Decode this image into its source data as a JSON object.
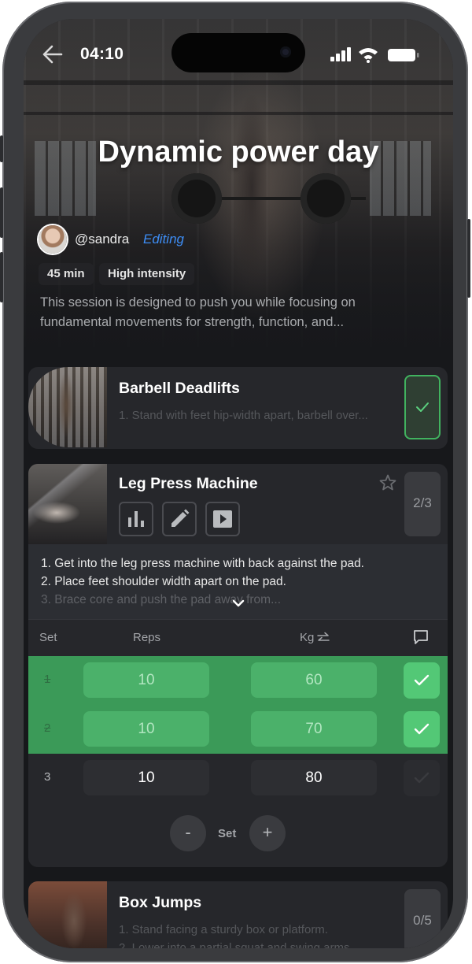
{
  "status_bar": {
    "time": "04:10"
  },
  "workout": {
    "title": "Dynamic power day",
    "author": "@sandra",
    "mode": "Editing",
    "duration": "45 min",
    "intensity": "High intensity",
    "description": "This session is designed to push you while focusing on fundamental movements for strength, function, and..."
  },
  "exercises": [
    {
      "name": "Barbell Deadlifts",
      "preview": "1. Stand with feet hip-width apart, barbell over...",
      "completed": true
    },
    {
      "name": "Leg Press Machine",
      "progress": "2/3",
      "instructions": [
        "1. Get into the leg press machine with back against the pad.",
        "2. Place feet shoulder width apart on the pad.",
        "3. Brace core and push the pad away from..."
      ],
      "table": {
        "headers": {
          "set": "Set",
          "reps": "Reps",
          "kg": "Kg"
        },
        "sets": [
          {
            "set": "1",
            "reps": "10",
            "kg": "60",
            "done": true
          },
          {
            "set": "2",
            "reps": "10",
            "kg": "70",
            "done": true
          },
          {
            "set": "3",
            "reps": "10",
            "kg": "80",
            "done": false
          }
        ],
        "remove_label": "-",
        "set_label": "Set",
        "add_label": "+"
      }
    },
    {
      "name": "Box Jumps",
      "progress": "0/5",
      "preview_lines": [
        "1. Stand facing a sturdy box or platform.",
        "2. Lower into a partial squat and swing arms..."
      ]
    }
  ],
  "icons": {
    "back": "arrow-left-icon",
    "signal": "cellular-signal-icon",
    "wifi": "wifi-icon",
    "battery": "battery-icon",
    "check": "checkmark-icon",
    "star": "star-outline-icon",
    "chart": "bar-chart-icon",
    "edit": "pencil-icon",
    "video": "play-video-icon",
    "expand": "chevron-down-icon",
    "swap": "swap-arrows-icon",
    "comment": "comment-icon"
  },
  "colors": {
    "accent_blue": "#3d8df5",
    "done_green": "#3b9a58",
    "check_green": "#53c876",
    "background": "#17181b",
    "card": "#26272b"
  }
}
